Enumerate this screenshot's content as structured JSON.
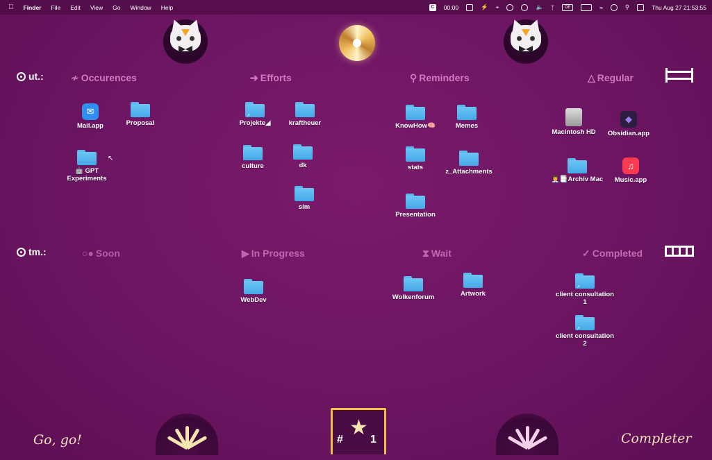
{
  "menubar": {
    "apple": "",
    "app": "Finder",
    "menus": [
      "File",
      "Edit",
      "View",
      "Go",
      "Window",
      "Help"
    ],
    "timer": "00:00",
    "input_source": "DE",
    "datetime": "Thu Aug 27  21:53:55"
  },
  "rows": {
    "top": {
      "label": "ut.:"
    },
    "bottom": {
      "label": "tm.:"
    }
  },
  "columns_top": [
    {
      "glyph": "≁",
      "label": "Occurences"
    },
    {
      "glyph": "➔",
      "label": "Efforts"
    },
    {
      "glyph": "⚲",
      "label": "Reminders"
    },
    {
      "glyph": "△",
      "label": "Regular"
    }
  ],
  "columns_bottom": [
    {
      "glyph": "○●",
      "label": "Soon"
    },
    {
      "glyph": "▶",
      "label": "In Progress"
    },
    {
      "glyph": "⧗",
      "label": "Wait"
    },
    {
      "glyph": "✓",
      "label": "Completed"
    }
  ],
  "items": {
    "mail": "Mail.app",
    "proposal": "Proposal",
    "gpt": "🤖 GPT Experiments",
    "projekte": "Projekte◢",
    "kraftheuer": "kraftheuer",
    "culture": "culture",
    "dk": "dk",
    "slm": "slm",
    "knowhow": "KnowHow🧠",
    "memes": "Memes",
    "stats": "stats",
    "attachments": "z_Attachments",
    "presentation": "Presentation",
    "macintosh": "Macintosh HD",
    "obsidian": "Obsidian.app",
    "archiv": "👨‍💼📑Archiv Mac",
    "music": "Music.app",
    "webdev": "WebDev",
    "wolkenforum": "Wolkenforum",
    "artwork": "Artwork",
    "client1": "client consultation 1",
    "client2": "client consultation 2"
  },
  "bottom": {
    "left_text": "Go, go!",
    "right_text": "Completer",
    "badge_hash": "#",
    "badge_num": "1"
  },
  "colors": {
    "background": "#6e1664",
    "header": "#d678c0",
    "folder": "#5bb8ef",
    "accent": "#f0c040"
  }
}
